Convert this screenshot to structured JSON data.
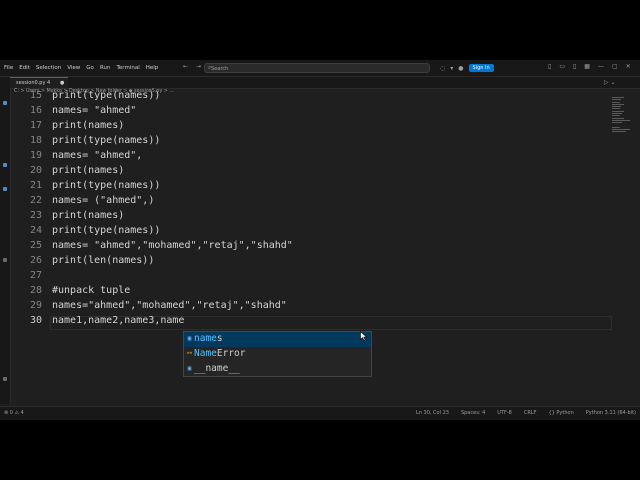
{
  "menu": [
    "File",
    "Edit",
    "Selection",
    "View",
    "Go",
    "Run",
    "Terminal",
    "Help"
  ],
  "search": {
    "placeholder": "Search"
  },
  "toolbar": {
    "sign_in": "Sign In"
  },
  "tab": {
    "filename": "session0.py 4",
    "modified": "●"
  },
  "breadcrumb": "C: > Users > Mekko > Desktop > New folder > ◆ session5.py > ...",
  "lines": [
    {
      "num": "15",
      "text": "print(type(names))"
    },
    {
      "num": "16",
      "text": "names= \"ahmed\""
    },
    {
      "num": "17",
      "text": "print(names)"
    },
    {
      "num": "18",
      "text": "print(type(names))"
    },
    {
      "num": "19",
      "text": "names= \"ahmed\","
    },
    {
      "num": "20",
      "text": "print(names)"
    },
    {
      "num": "21",
      "text": "print(type(names))"
    },
    {
      "num": "22",
      "text": "names= (\"ahmed\",)"
    },
    {
      "num": "23",
      "text": "print(names)"
    },
    {
      "num": "24",
      "text": "print(type(names))"
    },
    {
      "num": "25",
      "text": "names= \"ahmed\",\"mohamed\",\"retaj\",\"shahd\""
    },
    {
      "num": "26",
      "text": "print(len(names))"
    },
    {
      "num": "27",
      "text": ""
    },
    {
      "num": "28",
      "text": "#unpack tuple"
    },
    {
      "num": "29",
      "text": "names=\"ahmed\",\"mohamed\",\"retaj\",\"shahd\""
    },
    {
      "num": "30",
      "text": "name1,name2,name3,name"
    }
  ],
  "suggestions": [
    {
      "match": "name",
      "rest": "s",
      "icon": "variable-icon"
    },
    {
      "match": "Name",
      "rest": "Error",
      "icon": "class-icon"
    },
    {
      "match": "__name__",
      "rest": "",
      "icon": "variable-icon"
    }
  ],
  "status": {
    "errors": "⊗ 0 ⚠ 4",
    "position": "Ln 30, Col 23",
    "spaces": "Spaces: 4",
    "encoding": "UTF-8",
    "eol": "CRLF",
    "language": "{} Python",
    "interpreter": "Python 3.11 (64-bit)"
  }
}
